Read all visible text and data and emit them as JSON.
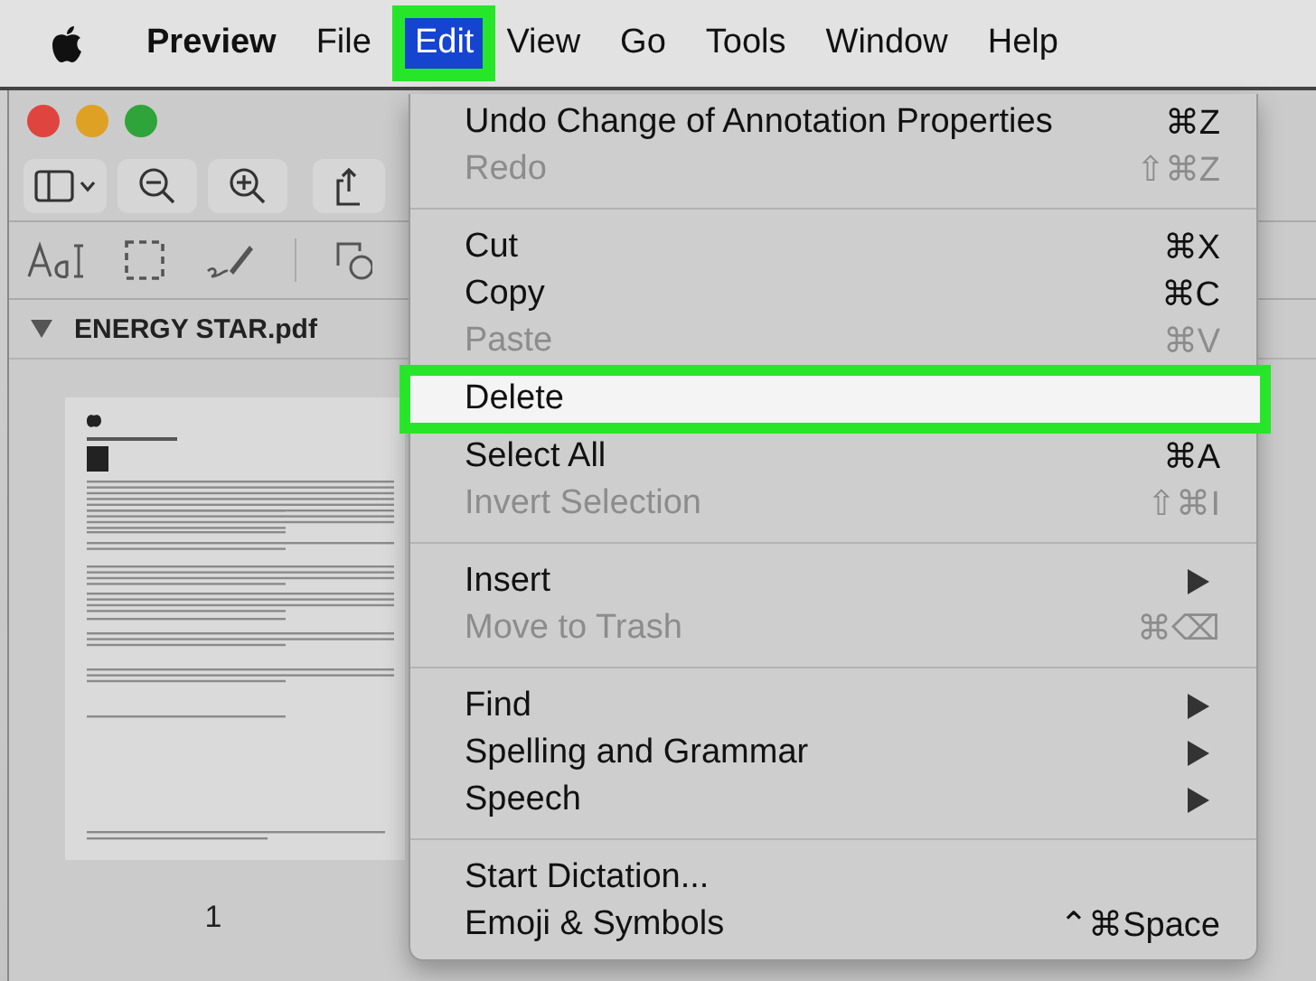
{
  "menu_bar": {
    "items": [
      {
        "label": "Preview",
        "kind": "app",
        "selected": false
      },
      {
        "label": "File",
        "kind": "menu",
        "selected": false
      },
      {
        "label": "Edit",
        "kind": "menu",
        "selected": true
      },
      {
        "label": "View",
        "kind": "menu",
        "selected": false
      },
      {
        "label": "Go",
        "kind": "menu",
        "selected": false
      },
      {
        "label": "Tools",
        "kind": "menu",
        "selected": false
      },
      {
        "label": "Window",
        "kind": "menu",
        "selected": false
      },
      {
        "label": "Help",
        "kind": "menu",
        "selected": false
      }
    ]
  },
  "window": {
    "sidebar": {
      "file_name": "ENERGY STAR.pdf",
      "expanded": true,
      "page_number": "1"
    }
  },
  "edit_menu": {
    "groups": [
      {
        "items": [
          {
            "label": "Undo Change of Annotation Properties",
            "shortcut": "⌘Z",
            "disabled": false,
            "selected": false,
            "submenu": false
          },
          {
            "label": "Redo",
            "shortcut": "⇧⌘Z",
            "disabled": true,
            "selected": false,
            "submenu": false
          }
        ]
      },
      {
        "items": [
          {
            "label": "Cut",
            "shortcut": "⌘X",
            "disabled": false,
            "selected": false,
            "submenu": false
          },
          {
            "label": "Copy",
            "shortcut": "⌘C",
            "disabled": false,
            "selected": false,
            "submenu": false
          },
          {
            "label": "Paste",
            "shortcut": "⌘V",
            "disabled": true,
            "selected": false,
            "submenu": false
          },
          {
            "label": "Delete",
            "disabled": false,
            "selected": true,
            "submenu": false
          },
          {
            "label": "Select All",
            "shortcut": "⌘A",
            "disabled": false,
            "selected": false,
            "submenu": false
          },
          {
            "label": "Invert Selection",
            "shortcut": "⇧⌘I",
            "disabled": true,
            "selected": false,
            "submenu": false
          }
        ]
      },
      {
        "items": [
          {
            "label": "Insert",
            "disabled": false,
            "selected": false,
            "submenu": true
          },
          {
            "label": "Move to Trash",
            "shortcut": "⌘⌫",
            "disabled": true,
            "selected": false,
            "submenu": false
          }
        ]
      },
      {
        "items": [
          {
            "label": "Find",
            "disabled": false,
            "selected": false,
            "submenu": true
          },
          {
            "label": "Spelling and Grammar",
            "disabled": false,
            "selected": false,
            "submenu": true
          },
          {
            "label": "Speech",
            "disabled": false,
            "selected": false,
            "submenu": true
          }
        ]
      },
      {
        "items": [
          {
            "label": "Start Dictation...",
            "disabled": false,
            "selected": false,
            "submenu": false
          },
          {
            "label": "Emoji & Symbols",
            "shortcut": "⌃⌘Space",
            "disabled": false,
            "selected": false,
            "submenu": false
          }
        ]
      }
    ]
  }
}
